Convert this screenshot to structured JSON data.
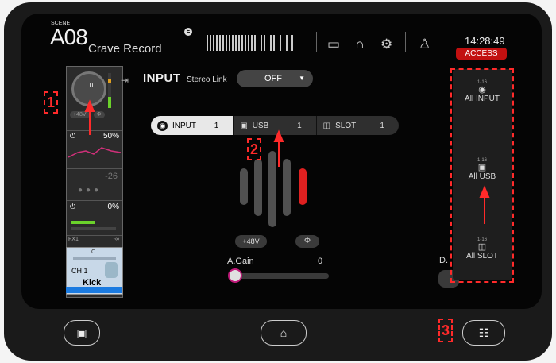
{
  "header": {
    "scene_label": "SCENE",
    "scene_number": "A08",
    "scene_name": "Crave Record",
    "edit_mark": "E",
    "time": "14:28:49",
    "access_label": "ACCESS"
  },
  "channel_strip": {
    "gain_value": "0",
    "phantom_label": "+48V",
    "phase_label": "Φ",
    "eq_value": "50%",
    "dyn_value": "-26",
    "send_value": "0%",
    "fx_label": "FX1",
    "fx_value": "-∞",
    "pan_label": "C",
    "channel_number": "CH 1",
    "channel_name": "Kick"
  },
  "input_panel": {
    "title": "INPUT",
    "stereo_link_label": "Stereo Link",
    "stereo_link_value": "OFF",
    "tabs": [
      {
        "label": "INPUT",
        "number": "1",
        "icon": "xlr-icon"
      },
      {
        "label": "USB",
        "number": "1",
        "icon": "usb-icon"
      },
      {
        "label": "SLOT",
        "number": "1",
        "icon": "slot-icon"
      }
    ],
    "phantom_label": "+48V",
    "phase_label": "Φ",
    "gain_label": "A.Gain",
    "gain_value": "0",
    "d_label": "D."
  },
  "side_panel": {
    "items": [
      {
        "range": "1-16",
        "label": "All INPUT",
        "icon": "xlr-icon"
      },
      {
        "range": "1-16",
        "label": "All USB",
        "icon": "usb-icon"
      },
      {
        "range": "1-16",
        "label": "All SLOT",
        "icon": "slot-icon"
      }
    ]
  },
  "annotations": [
    "1",
    "2",
    "3"
  ],
  "colors": {
    "accent_red": "#c21010",
    "annotation": "#ff2a2a",
    "meter_green": "#6bd22b",
    "selected_bar": "#e02020",
    "channel_blue": "#1a7ae0"
  }
}
